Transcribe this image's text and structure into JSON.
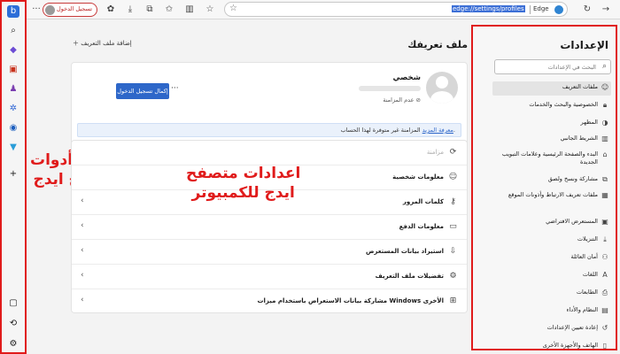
{
  "toolbar": {
    "signin_label": "تسجيل الدخول",
    "url": "edge://settings/profiles",
    "url_visible": "edge://settings/profiles",
    "edge_label": "Edge"
  },
  "main": {
    "section_title": "ملف تعريفك",
    "add_profile": "إضافة ملف التعريف",
    "profile": {
      "name": "شخصي",
      "sync_status": "عدم المزامنة",
      "complete_signin_button": "إكمال تسجيل الدخول",
      "sync_banner": "المزامنة غير متوفرة لهذا الحساب.",
      "learn_more": "معرفة المزيد"
    },
    "rows": [
      {
        "label": "مزامنة",
        "icon": "sync-icon",
        "muted": true
      },
      {
        "label": "معلومات شخصية",
        "icon": "person-icon"
      },
      {
        "label": "كلمات المرور",
        "icon": "key-icon"
      },
      {
        "label": "معلومات الدفع",
        "icon": "card-icon"
      },
      {
        "label": "استيراد بيانات المستعرض",
        "icon": "import-icon"
      },
      {
        "label": "تفضيلات ملف التعريف",
        "icon": "profile-settings-icon"
      },
      {
        "label": "مشاركة بيانات الاستعراض باستخدام ميزات Windows الأخرى",
        "icon": "windows-icon"
      }
    ]
  },
  "annotations": {
    "left": [
      "شريط أدوات",
      "متصفح ايدج"
    ],
    "center": [
      "اعدادات متصفح",
      "ايدج للكمبيوتر"
    ]
  },
  "settings": {
    "title": "الإعدادات",
    "search_placeholder": "البحث في الإعدادات",
    "items": [
      {
        "label": "ملفات التعريف",
        "icon": "profile-icon",
        "active": true
      },
      {
        "label": "الخصوصية والبحث والخدمات",
        "icon": "lock-icon"
      },
      {
        "label": "المظهر",
        "icon": "appearance-icon"
      },
      {
        "label": "الشريط الجانبي",
        "icon": "sidebar-icon"
      },
      {
        "label": "البدء والصفحة الرئيسية وعلامات التبويب الجديدة",
        "icon": "home-icon"
      },
      {
        "label": "مشاركة ونسخ ولصق",
        "icon": "share-icon"
      },
      {
        "label": "ملفات تعريف الارتباط وأذونات الموقع",
        "icon": "cookie-icon"
      },
      {
        "label": "المستعرض الافتراضي",
        "icon": "browser-icon"
      },
      {
        "label": "التنزيلات",
        "icon": "download-icon"
      },
      {
        "label": "أمان العائلة",
        "icon": "family-icon"
      },
      {
        "label": "اللغات",
        "icon": "language-icon"
      },
      {
        "label": "الطابعات",
        "icon": "printer-icon"
      },
      {
        "label": "النظام والأداء",
        "icon": "system-icon"
      },
      {
        "label": "إعادة تعيين الإعدادات",
        "icon": "reset-icon"
      },
      {
        "label": "الهاتف والأجهزة الأخرى",
        "icon": "phone-icon"
      }
    ]
  }
}
